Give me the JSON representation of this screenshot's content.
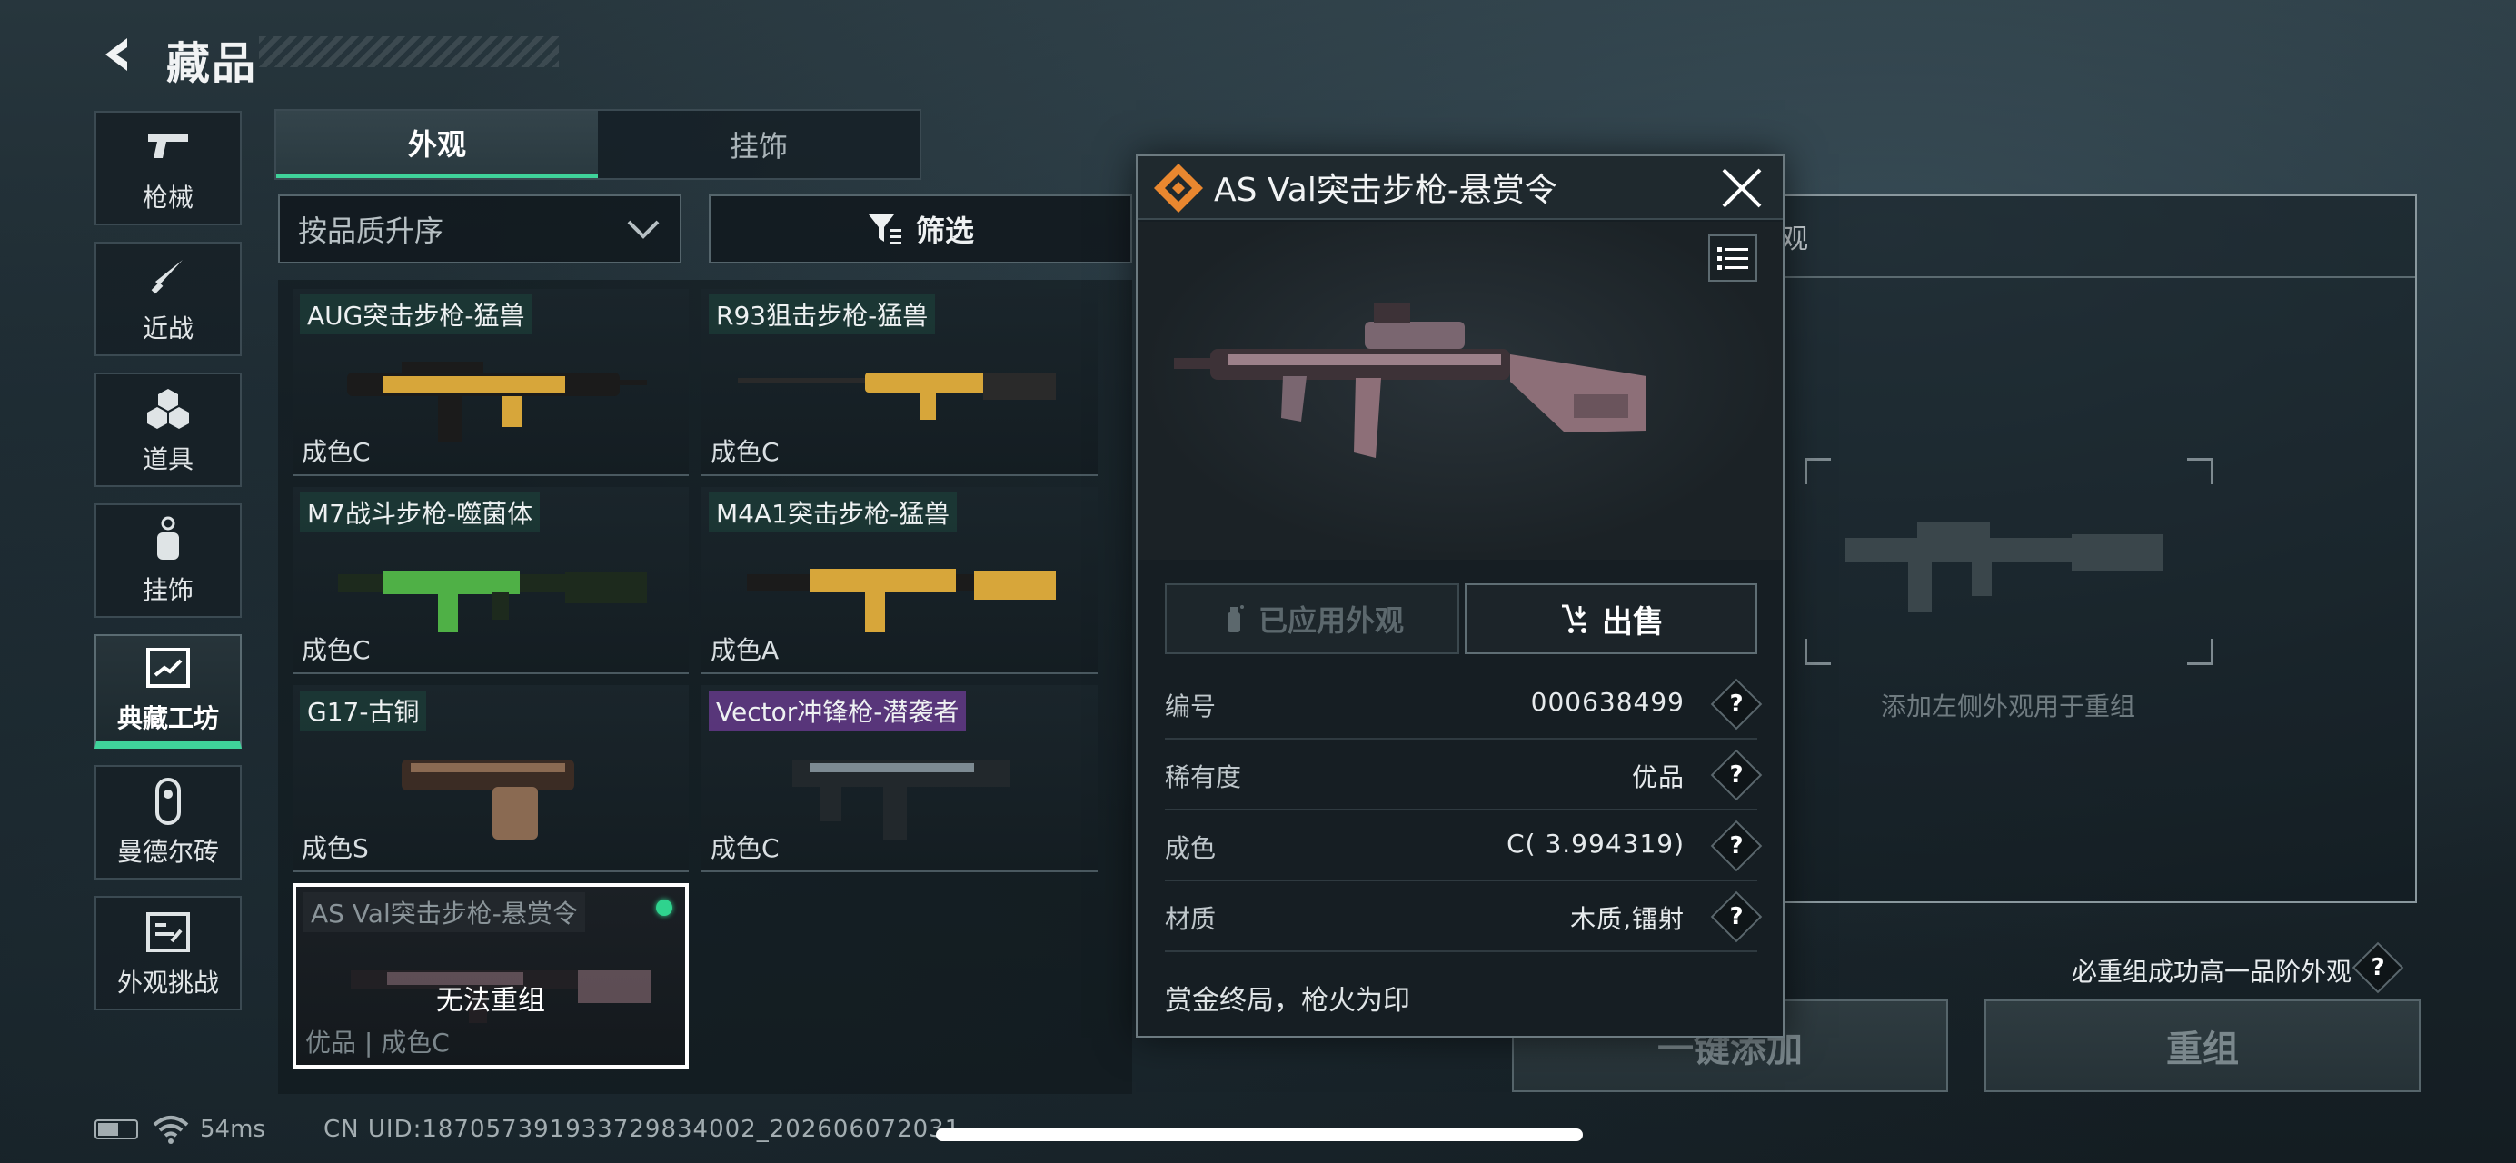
{
  "header": {
    "title": "藏品"
  },
  "categories": [
    {
      "label": "枪械",
      "icon": "gun-icon"
    },
    {
      "label": "近战",
      "icon": "knife-icon"
    },
    {
      "label": "道具",
      "icon": "props-icon"
    },
    {
      "label": "挂饰",
      "icon": "charm-icon"
    },
    {
      "label": "典藏工坊",
      "icon": "workshop-icon",
      "active": true
    },
    {
      "label": "曼德尔砖",
      "icon": "brick-icon"
    },
    {
      "label": "外观挑战",
      "icon": "challenge-icon"
    }
  ],
  "tabs": [
    {
      "label": "外观",
      "active": true
    },
    {
      "label": "挂饰",
      "active": false
    }
  ],
  "sort": {
    "selected": "按品质升序"
  },
  "filter": {
    "label": "筛选"
  },
  "skins": [
    {
      "name": "AUG突击步枪-猛兽",
      "grade": "成色C",
      "colors": [
        "#1b1b1b",
        "#d7a63a"
      ]
    },
    {
      "name": "R93狙击步枪-猛兽",
      "grade": "成色C",
      "colors": [
        "#2a2a2a",
        "#d7a63a"
      ]
    },
    {
      "name": "M7战斗步枪-噬菌体",
      "grade": "成色C",
      "colors": [
        "#1d2a1d",
        "#4fb046"
      ]
    },
    {
      "name": "M4A1突击步枪-猛兽",
      "grade": "成色A",
      "colors": [
        "#1b1b1b",
        "#d7a63a"
      ]
    },
    {
      "name": "G17-古铜",
      "grade": "成色S",
      "colors": [
        "#3b2c24",
        "#8a6a52"
      ]
    },
    {
      "name": "Vector冲锋枪-潜袭者",
      "grade": "成色C",
      "colors": [
        "#22282c",
        "#7d8a92"
      ],
      "name_style": "purple"
    },
    {
      "name": "AS Val突击步枪-悬赏令",
      "grade": "优品 | 成色C",
      "colors": [
        "#2a2326",
        "#8d6f78"
      ],
      "selected": true,
      "overlay": "无法重组"
    }
  ],
  "detail": {
    "title": "AS Val突击步枪-悬赏令",
    "applied_label": "已应用外观",
    "sell_label": "出售",
    "attributes": [
      {
        "label": "编号",
        "value": "000638499"
      },
      {
        "label": "稀有度",
        "value": "优品"
      },
      {
        "label": "成色",
        "value": "C( 3.994319)"
      },
      {
        "label": "材质",
        "value": "木质,镭射"
      }
    ],
    "description": "赏金终局，枪火为印",
    "accent": "#e9872f"
  },
  "recombine": {
    "title_fragment": "观",
    "slot_hint": "添加左侧外观用于重组",
    "higher_tier_label": "必重组成功高一品阶外观",
    "auto_add_label": "一键添加",
    "recombine_label": "重组"
  },
  "status": {
    "ping": "54ms",
    "uid": "CN UID:18705739193372983​4002_202606072031"
  }
}
